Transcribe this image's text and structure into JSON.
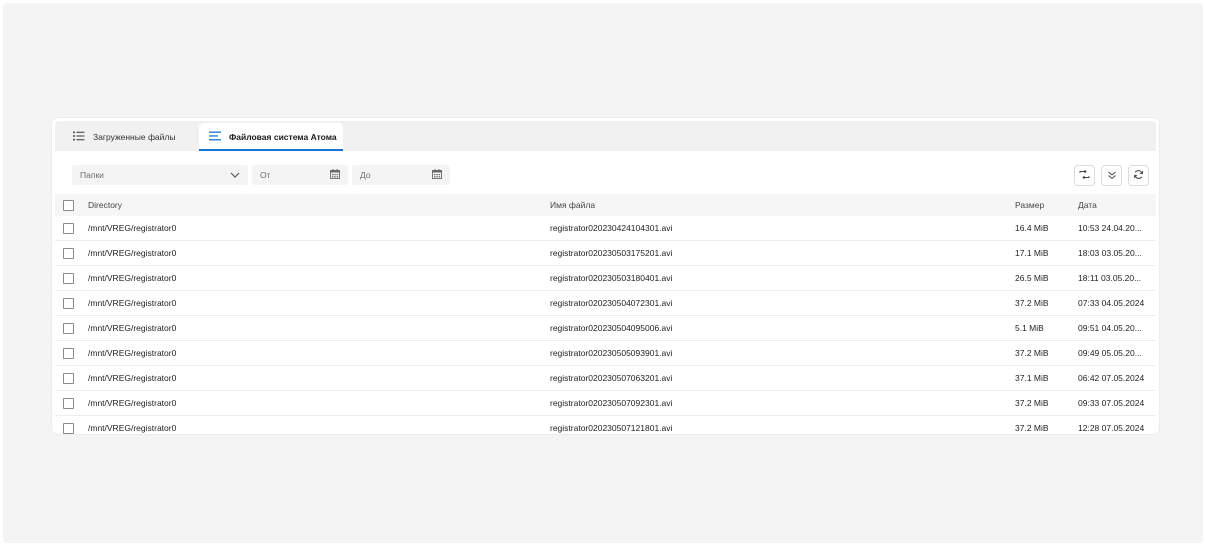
{
  "tabs": [
    {
      "label": "Загруженные файлы",
      "icon": "list-icon"
    },
    {
      "label": "Файловая система Атома",
      "icon": "menu-lines-icon"
    }
  ],
  "filters": {
    "folders_placeholder": "Папки",
    "from_placeholder": "От",
    "to_placeholder": "До"
  },
  "table": {
    "headers": [
      "Directory",
      "Имя файла",
      "Размер",
      "Дата"
    ],
    "rows": [
      {
        "dir": "/mnt/VREG/registrator0",
        "name": "registrator020230424104301.avi",
        "size": "16.4 MiB",
        "date": "10:53 24.04.20..."
      },
      {
        "dir": "/mnt/VREG/registrator0",
        "name": "registrator020230503175201.avi",
        "size": "17.1 MiB",
        "date": "18:03 03.05.20..."
      },
      {
        "dir": "/mnt/VREG/registrator0",
        "name": "registrator020230503180401.avi",
        "size": "26.5 MiB",
        "date": "18:11 03.05.20..."
      },
      {
        "dir": "/mnt/VREG/registrator0",
        "name": "registrator020230504072301.avi",
        "size": "37.2 MiB",
        "date": "07:33 04.05.2024"
      },
      {
        "dir": "/mnt/VREG/registrator0",
        "name": "registrator020230504095006.avi",
        "size": "5.1 MiB",
        "date": "09:51 04.05.20..."
      },
      {
        "dir": "/mnt/VREG/registrator0",
        "name": "registrator020230505093901.avi",
        "size": "37.2 MiB",
        "date": "09:49 05.05.20..."
      },
      {
        "dir": "/mnt/VREG/registrator0",
        "name": "registrator020230507063201.avi",
        "size": "37.1 MiB",
        "date": "06:42 07.05.2024"
      },
      {
        "dir": "/mnt/VREG/registrator0",
        "name": "registrator020230507092301.avi",
        "size": "37.2 MiB",
        "date": "09:33 07.05.2024"
      },
      {
        "dir": "/mnt/VREG/registrator0",
        "name": "registrator020230507121801.avi",
        "size": "37.2 MiB",
        "date": "12:28 07.05.2024"
      }
    ]
  },
  "colors": {
    "accent": "#1677d6",
    "page_bg": "#f4f4f4",
    "header_bg": "#f6f6f6"
  }
}
